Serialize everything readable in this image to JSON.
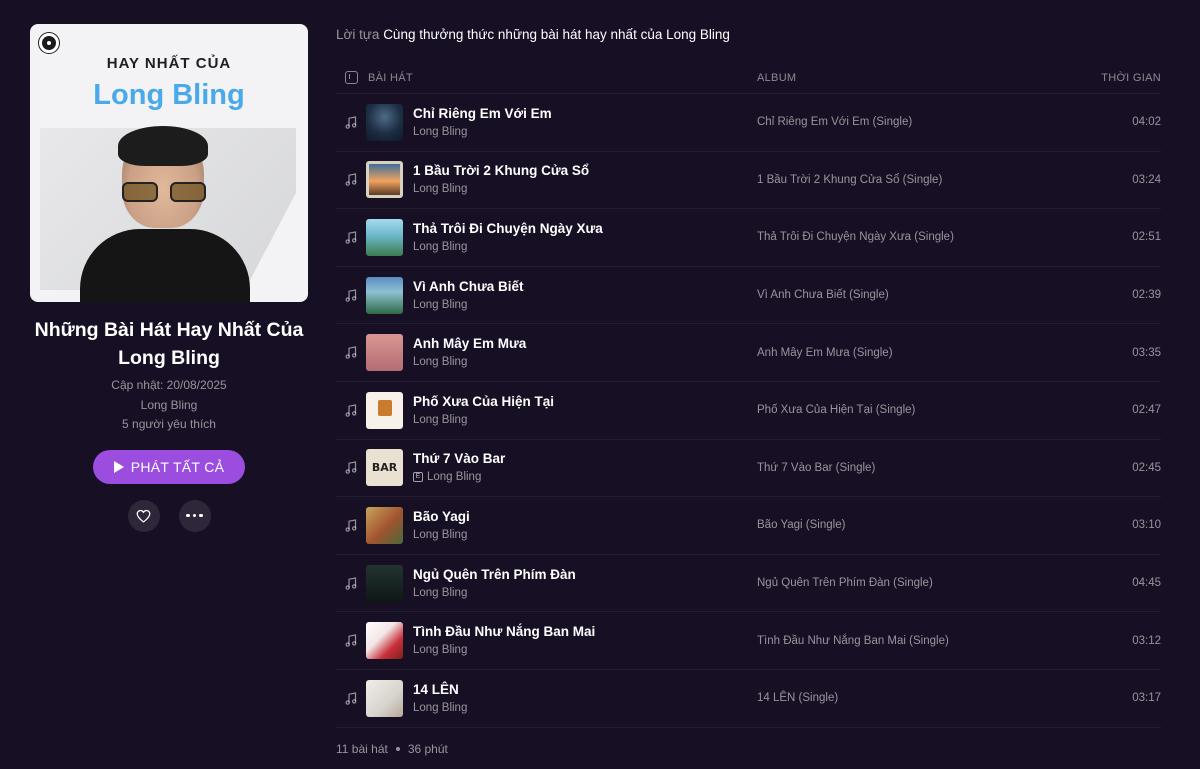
{
  "playlist": {
    "cover_line1": "HAY NHẤT CỦA",
    "cover_line2": "Long Bling",
    "title": "Những Bài Hát Hay Nhất Của Long Bling",
    "updated": "Cập nhật: 20/08/2025",
    "artist": "Long Bling",
    "likes": "5 người yêu thích",
    "play_all_label": "PHÁT TẤT CẢ"
  },
  "intro": {
    "label": "Lời tựa",
    "text": "Cùng thưởng thức những bài hát hay nhất của Long Bling"
  },
  "table": {
    "header_song": "BÀI HÁT",
    "header_album": "ALBUM",
    "header_time": "THỜI GIAN",
    "rows": [
      {
        "title": "Chỉ Riêng Em Với Em",
        "artist": "Long Bling",
        "album": "Chỉ Riêng Em Với Em (Single)",
        "duration": "04:02"
      },
      {
        "title": "1 Bầu Trời 2 Khung Cửa Sổ",
        "artist": "Long Bling",
        "album": "1 Bầu Trời 2 Khung Cửa Sổ (Single)",
        "duration": "03:24"
      },
      {
        "title": "Thả Trôi Đi Chuyện Ngày Xưa",
        "artist": "Long Bling",
        "album": "Thả Trôi Đi Chuyện Ngày Xưa (Single)",
        "duration": "02:51"
      },
      {
        "title": "Vì Anh Chưa Biết",
        "artist": "Long Bling",
        "album": "Vì Anh Chưa Biết (Single)",
        "duration": "02:39"
      },
      {
        "title": "Anh Mây Em Mưa",
        "artist": "Long Bling",
        "album": "Anh Mây Em Mưa (Single)",
        "duration": "03:35"
      },
      {
        "title": "Phố Xưa Của Hiện Tại",
        "artist": "Long Bling",
        "album": "Phố Xưa Của Hiện Tại (Single)",
        "duration": "02:47"
      },
      {
        "title": "Thứ 7 Vào Bar",
        "artist": "Long Bling",
        "album": "Thứ 7 Vào Bar (Single)",
        "duration": "02:45",
        "explicit": "E",
        "thumb_text": "BAR"
      },
      {
        "title": "Bão Yagi",
        "artist": "Long Bling",
        "album": "Bão Yagi (Single)",
        "duration": "03:10"
      },
      {
        "title": "Ngủ Quên Trên Phím Đàn",
        "artist": "Long Bling",
        "album": "Ngủ Quên Trên Phím Đàn (Single)",
        "duration": "04:45"
      },
      {
        "title": "Tình Đầu Như Nắng Ban Mai",
        "artist": "Long Bling",
        "album": "Tình Đầu Như Nắng Ban Mai (Single)",
        "duration": "03:12"
      },
      {
        "title": "14 LÊN",
        "artist": "Long Bling",
        "album": "14 LÊN (Single)",
        "duration": "03:17"
      }
    ]
  },
  "footer": {
    "count": "11 bài hát",
    "total": "36 phút"
  },
  "colors": {
    "background": "#170f23",
    "accent": "#9b4de0",
    "cover_title": "#4aa9e8"
  },
  "icons": [
    "disc-icon",
    "play-icon",
    "heart-icon",
    "more-icon",
    "music-note-icon",
    "sort-icon",
    "explicit-icon"
  ]
}
